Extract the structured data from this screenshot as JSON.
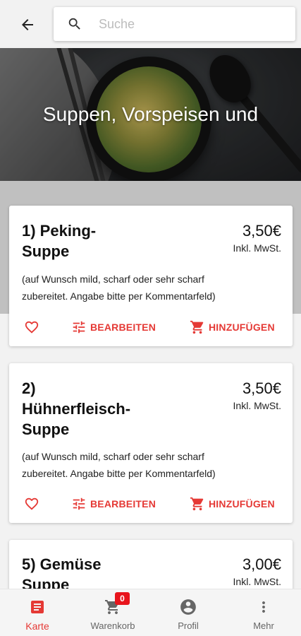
{
  "header": {
    "back_icon": "arrow-left-icon",
    "search": {
      "placeholder": "Suche",
      "value": "",
      "icon": "search-icon"
    }
  },
  "category": {
    "title": "Suppen, Vorspeisen und"
  },
  "actions": {
    "edit_label": "BEARBEITEN",
    "add_label": "HINZUFÜGEN",
    "fav_icon": "heart-outline-icon",
    "edit_icon": "tune-icon",
    "add_icon": "cart-add-icon"
  },
  "products": [
    {
      "name_lines": [
        "1) Peking-",
        "Suppe"
      ],
      "price": "3,50€",
      "tax": "Inkl. MwSt.",
      "desc_lines": [
        "(auf Wunsch mild, scharf oder sehr scharf",
        "zubereitet. Angabe bitte per Kommentarfeld)"
      ]
    },
    {
      "name_lines": [
        "2)",
        "Hühnerfleisch-",
        "Suppe"
      ],
      "price": "3,50€",
      "tax": "Inkl. MwSt.",
      "desc_lines": [
        "(auf Wunsch mild, scharf oder sehr scharf",
        "zubereitet. Angabe bitte per Kommentarfeld)"
      ]
    },
    {
      "name_lines": [
        "5) Gemüse",
        "Suppe"
      ],
      "price": "3,00€",
      "tax": "Inkl. MwSt."
    }
  ],
  "bottom_nav": {
    "items": [
      {
        "label": "Karte",
        "icon": "menu-card-icon",
        "active": true
      },
      {
        "label": "Warenkorb",
        "icon": "shopping-cart-icon",
        "badge": "0"
      },
      {
        "label": "Profil",
        "icon": "account-circle-icon"
      },
      {
        "label": "Mehr",
        "icon": "more-vertical-icon"
      }
    ]
  },
  "colors": {
    "accent": "#e53935",
    "badge": "#e8141c",
    "background": "#f2f2f2",
    "band": "#c0c0c0"
  }
}
